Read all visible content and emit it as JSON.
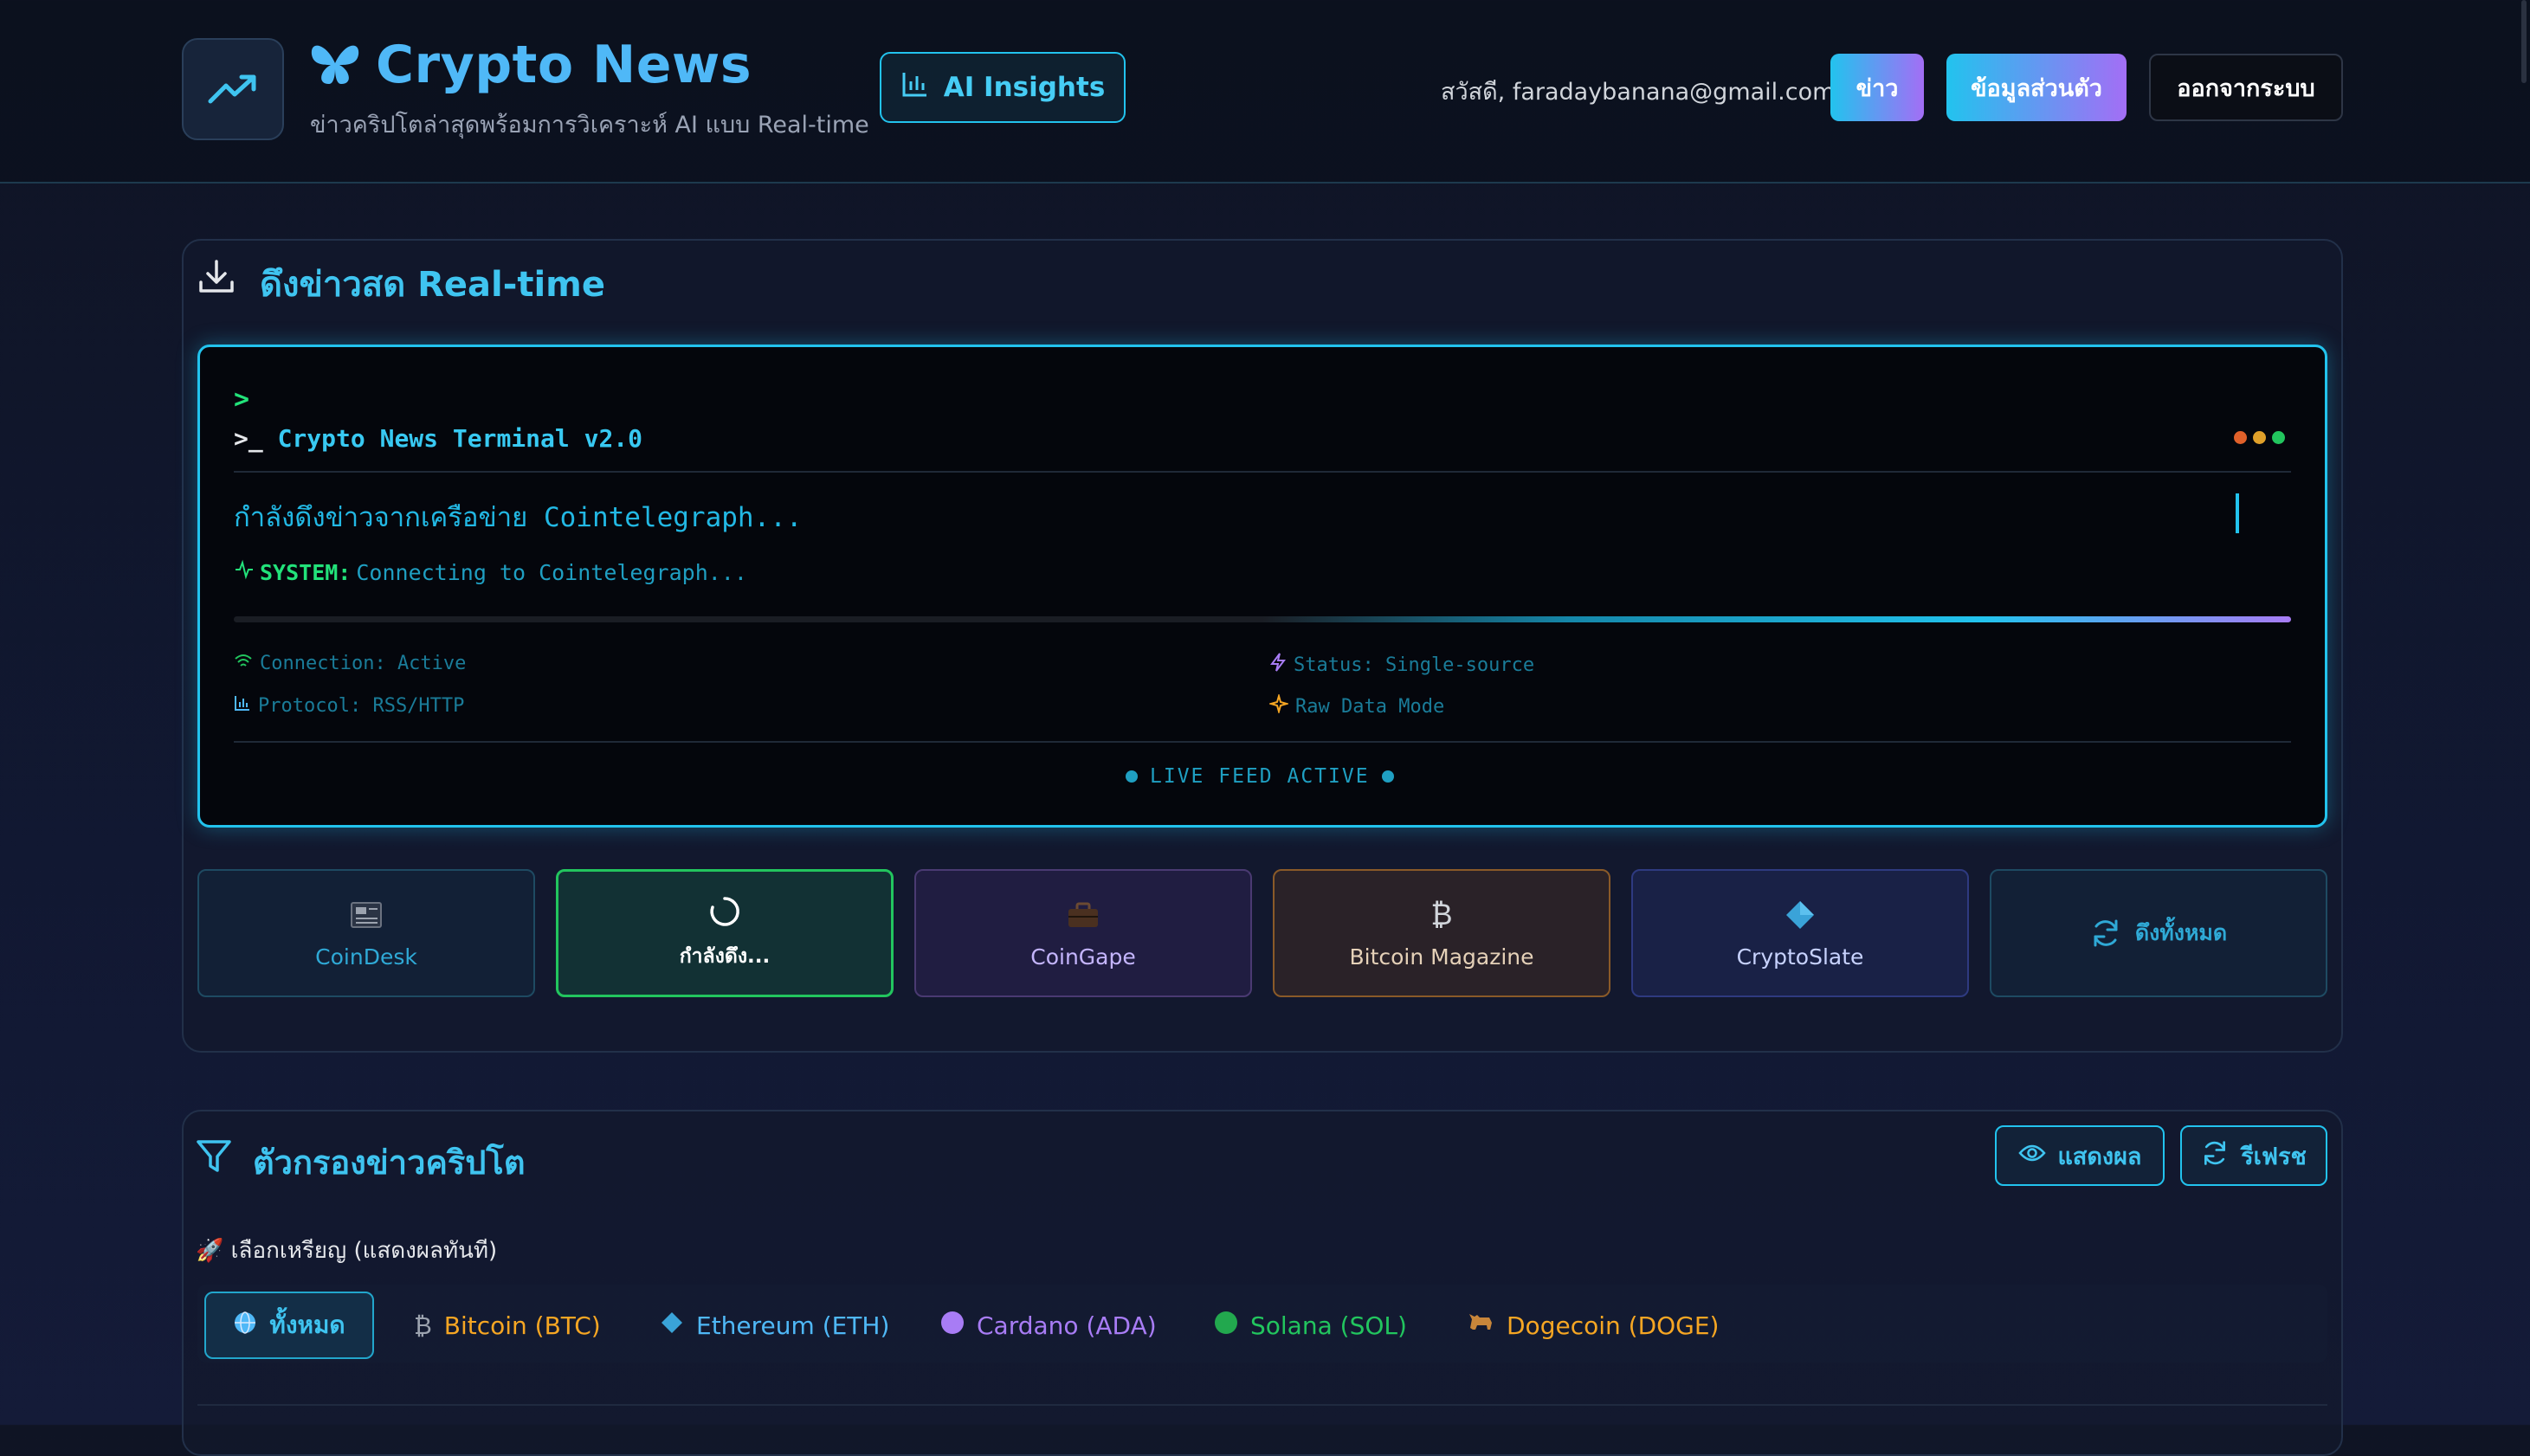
{
  "header": {
    "brand_title": "Crypto News",
    "brand_subtitle": "ข่าวคริปโตล่าสุดพร้อมการวิเคราะห์ AI แบบ Real-time",
    "insights_label": "AI Insights",
    "greeting": "สวัสดี, faradaybanana@gmail.com",
    "nav_news": "ข่าว",
    "nav_profile": "ข้อมูลส่วนตัว",
    "nav_logout": "ออกจากระบบ"
  },
  "fetch_panel": {
    "title": "ดึงข่าวสด Real-time",
    "terminal": {
      "prompt": ">",
      "title": "Crypto News Terminal v2.0",
      "message": "กำลังดึงข่าวจากเครือข่าย Cointelegraph...",
      "system_label": "SYSTEM:",
      "system_text": "Connecting to Cointelegraph...",
      "connection": "Connection: Active",
      "status": "Status: Single-source",
      "protocol": "Protocol: RSS/HTTP",
      "mode": "Raw Data Mode",
      "live": "LIVE FEED ACTIVE"
    },
    "sources": [
      {
        "label": "CoinDesk",
        "icon": "newspaper-icon"
      },
      {
        "label": "กำลังดึง...",
        "icon": "spinner-icon"
      },
      {
        "label": "CoinGape",
        "icon": "briefcase-icon"
      },
      {
        "label": "Bitcoin Magazine",
        "icon": "bitcoin-icon"
      },
      {
        "label": "CryptoSlate",
        "icon": "diamond-icon"
      },
      {
        "label": "ดึงทั้งหมด",
        "icon": "refresh-icon"
      }
    ]
  },
  "filter_panel": {
    "title": "ตัวกรองข่าวคริปโต",
    "show_label": "แสดงผล",
    "refresh_label": "รีเฟรช",
    "coin_label": "🚀 เลือกเหรียญ (แสดงผลทันที)",
    "coins": [
      {
        "label": "ทั้งหมด",
        "color": "#3fc4f0"
      },
      {
        "label": "Bitcoin (BTC)",
        "color": "#f6a623"
      },
      {
        "label": "Ethereum (ETH)",
        "color": "#4fb8f7"
      },
      {
        "label": "Cardano (ADA)",
        "color": "#a87cf5"
      },
      {
        "label": "Solana (SOL)",
        "color": "#22c55e"
      },
      {
        "label": "Dogecoin (DOGE)",
        "color": "#f6a623"
      }
    ]
  }
}
